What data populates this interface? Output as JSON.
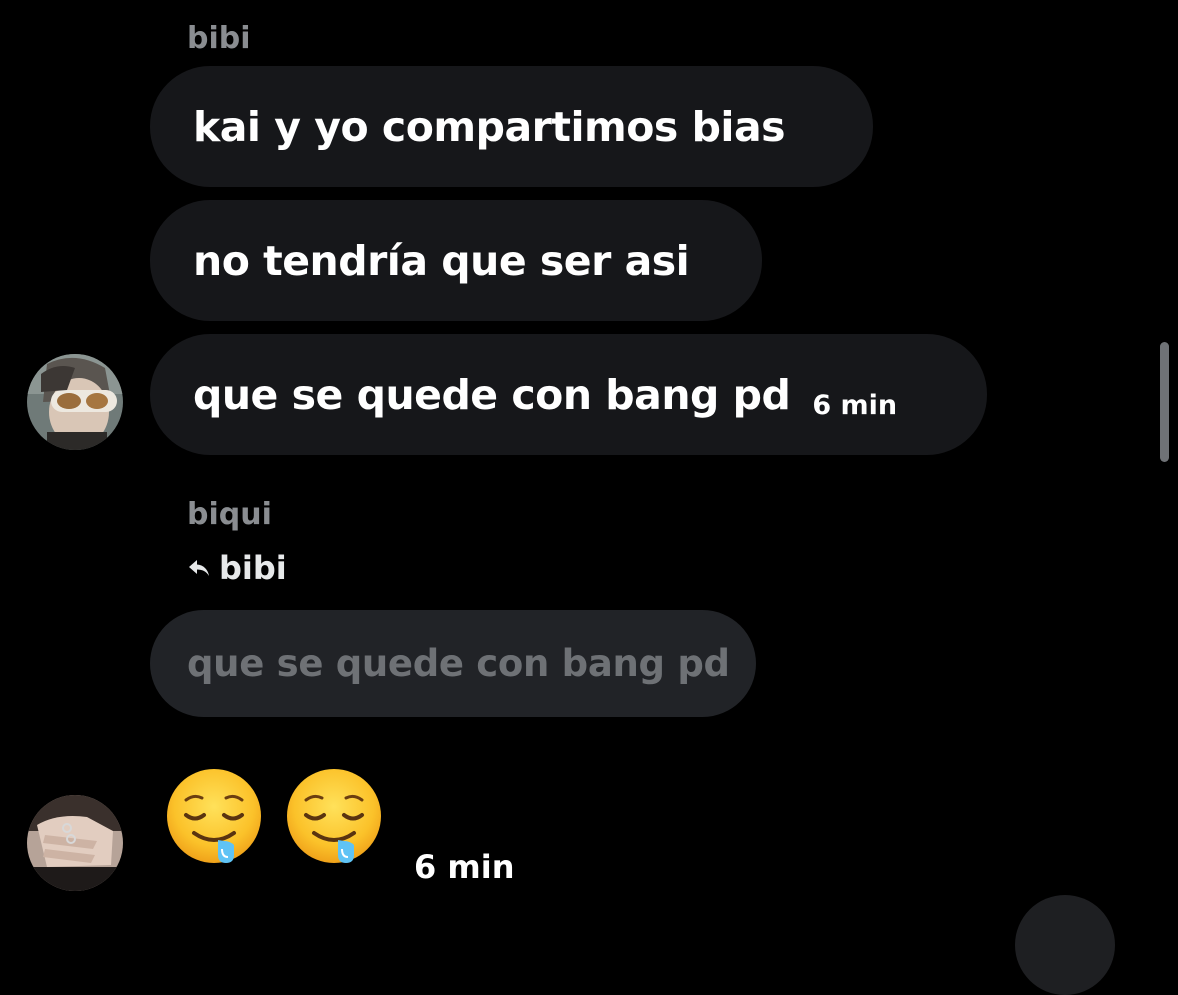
{
  "group1": {
    "sender": "bibi",
    "messages": [
      {
        "text": "kai y yo compartimos bias"
      },
      {
        "text": "no tendría que ser asi"
      },
      {
        "text": "que se quede con bang pd",
        "time": "6 min"
      }
    ]
  },
  "group2": {
    "sender": "biqui",
    "reply_to": "bibi",
    "quoted_text": "que se quede con bang pd",
    "emoji": [
      "drooling-face",
      "drooling-face"
    ],
    "time": "6 min"
  },
  "colors": {
    "background": "#000000",
    "bubble": "#16171a",
    "quoted_bubble": "#212327",
    "sender_name": "#8a8d91"
  }
}
